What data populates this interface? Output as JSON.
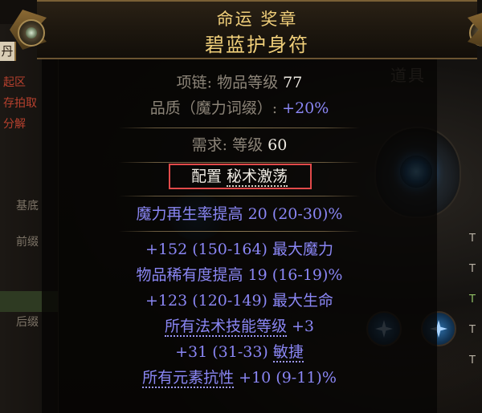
{
  "background": {
    "left_tab_fragment": "丹",
    "left_red_labels": [
      "起区",
      "存拍取",
      "分解"
    ],
    "left_tabs": [
      "基底",
      "前缀",
      "后缀"
    ],
    "stash_title": "道具",
    "right_labels": [
      "T",
      "T",
      "T",
      "T",
      "T"
    ]
  },
  "item": {
    "name": "命运 奖章",
    "base_type": "碧蓝护身符",
    "class_label": "项链",
    "item_level_label": "物品等级",
    "item_level": "77",
    "quality_label": "品质（魔力词缀）",
    "quality_value": "+20%",
    "requires_label": "需求",
    "requires_level_label": "等级",
    "requires_level": "60",
    "config_label": "配置",
    "config_value": "秘术激荡",
    "implicit": {
      "name": "魔力再生率提高",
      "value": "20 (20-30)%"
    },
    "mods": [
      {
        "value": "+152 (150-164)",
        "name": "最大魔力"
      },
      {
        "name": "物品稀有度提高",
        "value": "19 (16-19)%"
      },
      {
        "value": "+123 (120-149)",
        "name": "最大生命"
      },
      {
        "name": "所有法术技能等级",
        "value": "+3"
      },
      {
        "value": "+31 (31-33)",
        "name": "敏捷"
      },
      {
        "name": "所有元素抗性",
        "value": "+10 (9-11)%"
      }
    ]
  },
  "colors": {
    "title": "#f0cf7a",
    "property_label": "#8c8478",
    "property_value": "#f0ece4",
    "magic_mod": "#8a86f4",
    "highlight_box": "#e24a4a"
  },
  "icons": [
    "header-orb-icon",
    "amulet-icon",
    "ring-socket-icon"
  ]
}
